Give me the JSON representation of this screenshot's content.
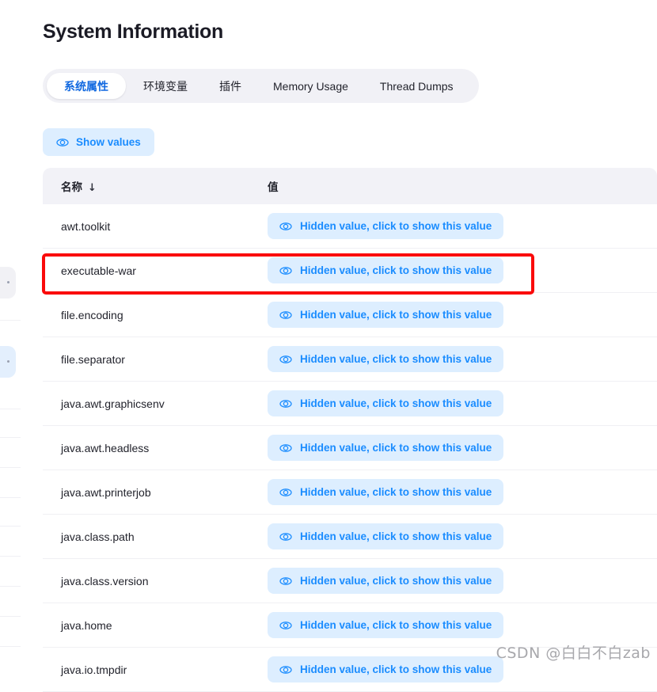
{
  "page": {
    "title": "System Information",
    "watermark": "CSDN @白白不白zab"
  },
  "tabs": [
    {
      "label": "系统属性",
      "active": true,
      "cjk": true
    },
    {
      "label": "环境变量",
      "active": false,
      "cjk": true
    },
    {
      "label": "插件",
      "active": false,
      "cjk": true
    },
    {
      "label": "Memory Usage",
      "active": false,
      "cjk": false
    },
    {
      "label": "Thread Dumps",
      "active": false,
      "cjk": false
    }
  ],
  "toolbar": {
    "show_values_label": "Show values",
    "show_values_icon": "eye-icon"
  },
  "table": {
    "columns": [
      {
        "label": "名称",
        "sort": "↓"
      },
      {
        "label": "值",
        "sort": ""
      }
    ],
    "value_placeholder": "Hidden value, click to show this value",
    "value_icon": "eye-icon",
    "rows": [
      {
        "name": "awt.toolkit",
        "highlighted": false
      },
      {
        "name": "executable-war",
        "highlighted": true
      },
      {
        "name": "file.encoding",
        "highlighted": false
      },
      {
        "name": "file.separator",
        "highlighted": false
      },
      {
        "name": "java.awt.graphicsenv",
        "highlighted": false
      },
      {
        "name": "java.awt.headless",
        "highlighted": false
      },
      {
        "name": "java.awt.printerjob",
        "highlighted": false
      },
      {
        "name": "java.class.path",
        "highlighted": false
      },
      {
        "name": "java.class.version",
        "highlighted": false
      },
      {
        "name": "java.home",
        "highlighted": false
      },
      {
        "name": "java.io.tmpdir",
        "highlighted": false
      }
    ]
  },
  "colors": {
    "accent_blue": "#1a8cff",
    "tab_active_blue": "#1269e0",
    "pill_bg": "#ddeeff",
    "tabbar_bg": "#f1f1f6",
    "header_bg": "#f2f2f7",
    "annotation_red": "#fa0a0a",
    "text_dark": "#22232c"
  }
}
